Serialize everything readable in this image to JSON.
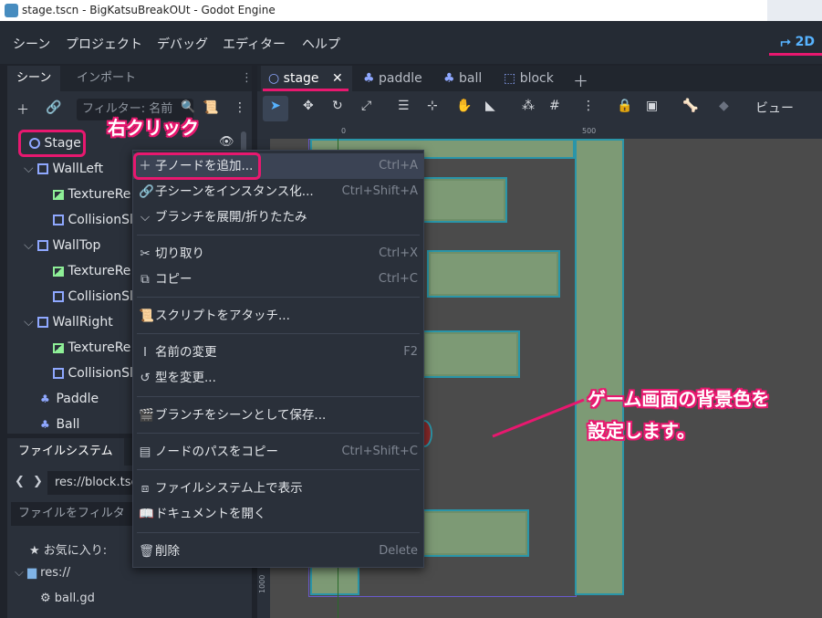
{
  "window": {
    "title": "stage.tscn - BigKatsuBreakOUt - Godot Engine"
  },
  "menubar": {
    "items": [
      "シーン",
      "プロジェクト",
      "デバッグ",
      "エディター",
      "ヘルプ"
    ],
    "mode_2d": "2D"
  },
  "scene_panel": {
    "tabs": [
      "シーン",
      "インポート"
    ],
    "filter_placeholder": "フィルター: 名前",
    "nodes": [
      {
        "label": "Stage",
        "type": "node"
      },
      {
        "label": "WallLeft",
        "type": "2d"
      },
      {
        "label": "TextureRe",
        "type": "texture"
      },
      {
        "label": "CollisionSl",
        "type": "collision"
      },
      {
        "label": "WallTop",
        "type": "2d"
      },
      {
        "label": "TextureRe",
        "type": "texture"
      },
      {
        "label": "CollisionSl",
        "type": "collision"
      },
      {
        "label": "WallRight",
        "type": "2d"
      },
      {
        "label": "TextureRe",
        "type": "texture"
      },
      {
        "label": "CollisionSl",
        "type": "collision"
      },
      {
        "label": "Paddle",
        "type": "character"
      },
      {
        "label": "Ball",
        "type": "character"
      }
    ]
  },
  "filesystem_panel": {
    "tab": "ファイルシステム",
    "path": "res://block.tscn",
    "filter_placeholder": "ファイルをフィルタ",
    "favorites": "お気に入り:",
    "root": "res://",
    "file": "ball.gd"
  },
  "doc_tabs": [
    "stage",
    "paddle",
    "ball",
    "block"
  ],
  "toolbar": {
    "view_label": "ビュー"
  },
  "ruler": {
    "top_marks": [
      "0",
      "500"
    ],
    "left_mark": "1000"
  },
  "context_menu": {
    "items": [
      {
        "icon": "plus-icon",
        "label": "子ノードを追加...",
        "shortcut": "Ctrl+A"
      },
      {
        "icon": "link-icon",
        "label": "子シーンをインスタンス化...",
        "shortcut": "Ctrl+Shift+A"
      },
      {
        "icon": "chevron-down-icon",
        "label": "ブランチを展開/折りたたみ",
        "shortcut": ""
      },
      {
        "icon": "scissors-icon",
        "label": "切り取り",
        "shortcut": "Ctrl+X"
      },
      {
        "icon": "copy-icon",
        "label": "コピー",
        "shortcut": "Ctrl+C"
      },
      {
        "icon": "script-attach-icon",
        "label": "スクリプトをアタッチ...",
        "shortcut": ""
      },
      {
        "icon": "text-cursor-icon",
        "label": "名前の変更",
        "shortcut": "F2"
      },
      {
        "icon": "rotate-icon",
        "label": "型を変更...",
        "shortcut": ""
      },
      {
        "icon": "save-branch-icon",
        "label": "ブランチをシーンとして保存...",
        "shortcut": ""
      },
      {
        "icon": "node-path-icon",
        "label": "ノードのパスをコピー",
        "shortcut": "Ctrl+Shift+C"
      },
      {
        "icon": "filesystem-show-icon",
        "label": "ファイルシステム上で表示",
        "shortcut": ""
      },
      {
        "icon": "doc-icon",
        "label": "ドキュメントを開く",
        "shortcut": ""
      },
      {
        "icon": "trash-icon",
        "label": "削除",
        "shortcut": "Delete"
      }
    ]
  },
  "annotations": {
    "right_click": "右クリック",
    "bg_line1": "ゲーム画面の背景色を",
    "bg_line2": "設定します。"
  },
  "colors": {
    "accent": "#57b3ff",
    "annotation_pink": "#e8186f",
    "viewport_bg": "#4b4b4b"
  }
}
